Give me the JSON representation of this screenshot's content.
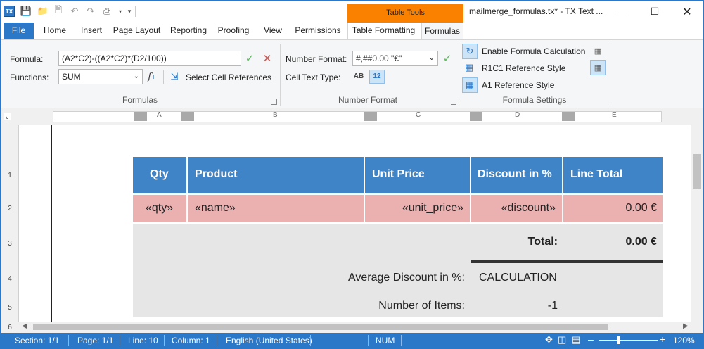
{
  "titlebar": {
    "title": "mailmerge_formulas.tx* - TX Text ...",
    "context_tab_group": "Table Tools"
  },
  "tabs": [
    "File",
    "Home",
    "Insert",
    "Page Layout",
    "Reporting",
    "Proofing",
    "View",
    "Permissions",
    "Table Formatting",
    "Formulas"
  ],
  "ribbon": {
    "formula_label": "Formula:",
    "formula_value": "(A2*C2)-((A2*C2)*(D2/100))",
    "functions_label": "Functions:",
    "functions_value": "SUM",
    "select_cell_refs": "Select Cell References",
    "group_formulas": "Formulas",
    "number_format_label": "Number Format:",
    "number_format_value": "#,##0.00 \"€\"",
    "cell_text_type_label": "Cell Text Type:",
    "text_type_ab": "AB",
    "text_type_12": "12",
    "group_number_format": "Number Format",
    "enable_formula": "Enable Formula Calculation",
    "r1c1": "R1C1 Reference Style",
    "a1": "A1 Reference Style",
    "group_formula_settings": "Formula Settings"
  },
  "ruler": {
    "columns": [
      "A",
      "B",
      "C",
      "D",
      "E"
    ]
  },
  "row_numbers": [
    "1",
    "2",
    "3",
    "4",
    "5",
    "6"
  ],
  "table": {
    "headers": [
      "Qty",
      "Product",
      "Unit Price",
      "Discount in %",
      "Line Total"
    ],
    "row": [
      "«qty»",
      "«name»",
      "«unit_price»",
      "«discount»",
      "0.00 €"
    ],
    "total_label": "Total:",
    "total_value": "0.00 €",
    "avg_label": "Average Discount in %:",
    "avg_value": "CALCULATION",
    "items_label": "Number of Items:",
    "items_value": "-1"
  },
  "status": {
    "section": "Section: 1/1",
    "page": "Page: 1/1",
    "line": "Line: 10",
    "column": "Column: 1",
    "language": "English (United States)",
    "num": "NUM",
    "zoom": "120%"
  },
  "colors": {
    "accent": "#2b78c8",
    "header_fill": "#3f84c6",
    "row_fill": "#ebb1b1",
    "grey_fill": "#e6e6e6",
    "table_tools": "#fa8000"
  }
}
